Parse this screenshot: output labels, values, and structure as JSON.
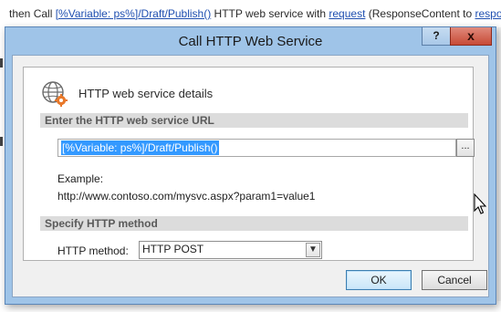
{
  "background": {
    "lead_text": "then Call ",
    "link_url_variable": "[%Variable: ps%]/Draft/Publish()",
    "mid_text": " HTTP web service with ",
    "link_request": "request",
    "tail_text": " (ResponseContent to ",
    "link_response": "respon"
  },
  "dialog": {
    "title": "Call HTTP Web Service",
    "help_label": "?",
    "close_label": "x",
    "header": "HTTP web service details",
    "url_section": {
      "title": "Enter the HTTP web service URL",
      "url_value": "[%Variable: ps%]/Draft/Publish()",
      "browse_label": "...",
      "example_label": "Example:",
      "example_value": "http://www.contoso.com/mysvc.aspx?param1=value1"
    },
    "method_section": {
      "title": "Specify HTTP method",
      "method_label": "HTTP method:",
      "method_value": "HTTP POST"
    },
    "ok_label": "OK",
    "cancel_label": "Cancel"
  },
  "colors": {
    "title_bar": "#9fc4e8",
    "selection": "#3399ff",
    "link": "#1f4fb0",
    "close": "#c74a36"
  }
}
